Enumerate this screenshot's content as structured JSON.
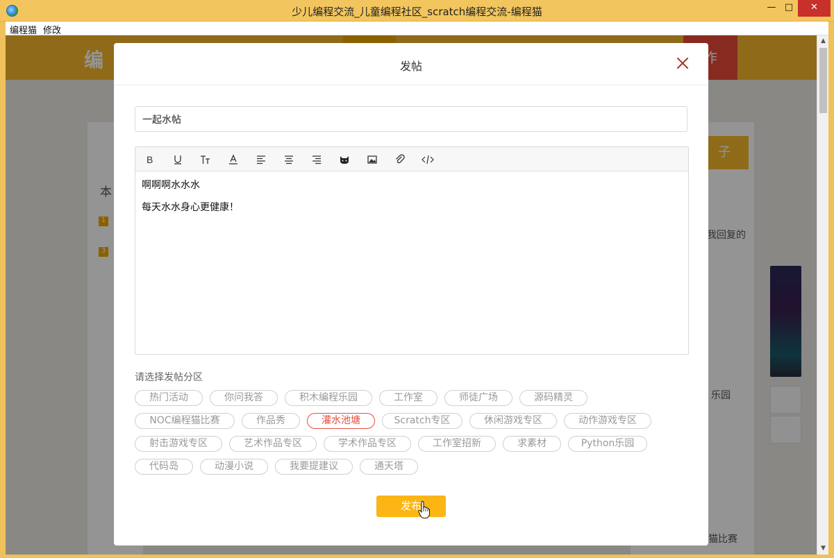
{
  "window": {
    "title": "少儿编程交流_儿童编程社区_scratch编程交流-编程猫",
    "min": "—",
    "max": "□",
    "close": "✕"
  },
  "menu": [
    "编程猫",
    "修改"
  ],
  "background": {
    "logo": "编",
    "create_button": "作",
    "post_button": "子",
    "left_texts": [
      "本",
      "1",
      "3"
    ],
    "right_texts": [
      "我回复的",
      "乐园",
      "猫比赛"
    ]
  },
  "modal": {
    "title": "发帖",
    "title_input_value": "一起水帖",
    "editor": {
      "lines": [
        "啊啊啊水水水",
        "每天水水身心更健康！"
      ]
    },
    "toolbar_icons": [
      "bold-icon",
      "underline-icon",
      "text-size-icon",
      "font-color-icon",
      "align-left-icon",
      "align-center-icon",
      "align-right-icon",
      "cat-emoji-icon",
      "image-icon",
      "attachment-icon",
      "code-icon"
    ],
    "category_label": "请选择发帖分区",
    "categories": [
      "热门活动",
      "你问我答",
      "积木编程乐园",
      "工作室",
      "师徒广场",
      "源码精灵",
      "NOC编程猫比赛",
      "作品秀",
      "灌水池塘",
      "Scratch专区",
      "休闲游戏专区",
      "动作游戏专区",
      "射击游戏专区",
      "艺术作品专区",
      "学术作品专区",
      "工作室招新",
      "求素材",
      "Python乐园",
      "代码岛",
      "动漫小说",
      "我要提建议",
      "通天塔"
    ],
    "selected_category": "灌水池塘",
    "publish_label": "发布"
  },
  "colors": {
    "accent": "#fbb515",
    "selected": "#e64d3d",
    "titlebar": "#f3c55e"
  }
}
